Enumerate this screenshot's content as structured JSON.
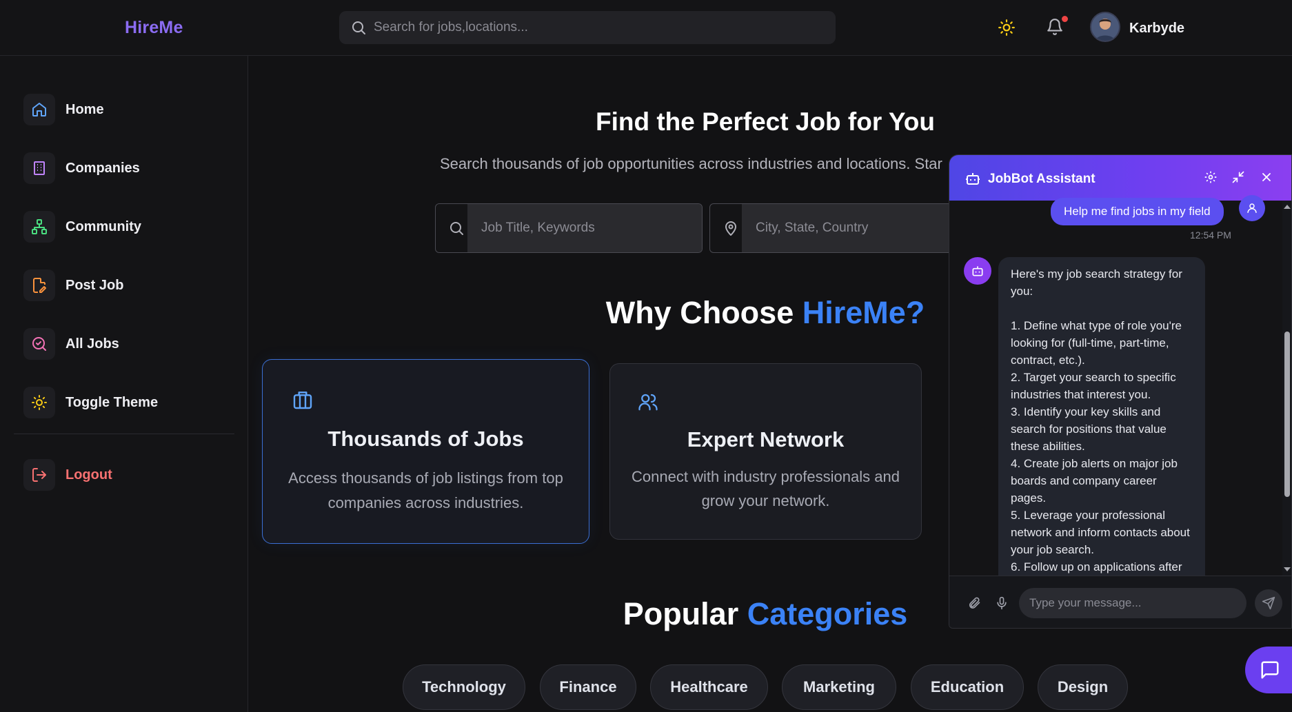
{
  "app": {
    "brand": "HireMe"
  },
  "header": {
    "search_placeholder": "Search for jobs,locations...",
    "username": "Karbyde"
  },
  "sidebar": {
    "items": [
      {
        "label": "Home",
        "icon": "home-icon"
      },
      {
        "label": "Companies",
        "icon": "building-icon"
      },
      {
        "label": "Community",
        "icon": "network-icon"
      },
      {
        "label": "Post Job",
        "icon": "file-edit-icon"
      },
      {
        "label": "All Jobs",
        "icon": "search-check-icon"
      },
      {
        "label": "Toggle Theme",
        "icon": "sun-icon"
      }
    ],
    "logout_label": "Logout"
  },
  "hero": {
    "title": "Find the Perfect Job for You",
    "subtitle": "Search thousands of job opportunities across industries and locations. Star",
    "job_placeholder": "Job Title, Keywords",
    "location_placeholder": "City, State, Country"
  },
  "why": {
    "title_prefix": "Why Choose ",
    "title_accent": "HireMe?",
    "cards": [
      {
        "title": "Thousands of Jobs",
        "desc": "Access thousands of job listings from top companies across industries."
      },
      {
        "title": "Expert Network",
        "desc": "Connect with industry professionals and grow your network."
      }
    ]
  },
  "categories": {
    "title_prefix": "Popular ",
    "title_accent": "Categories",
    "items": [
      "Technology",
      "Finance",
      "Healthcare",
      "Marketing",
      "Education",
      "Design"
    ]
  },
  "chat": {
    "title": "JobBot Assistant",
    "user_message": "Help me find jobs in my field",
    "time": "12:54 PM",
    "bot_message": "Here's my job search strategy for you:\n\n1. Define what type of role you're looking for (full-time, part-time, contract, etc.).\n2. Target your search to specific industries that interest you.\n3. Identify your key skills and search for positions that value these abilities.\n4. Create job alerts on major job boards and company career pages.\n5. Leverage your professional network and inform contacts about your job search.\n6. Follow up on applications after",
    "input_placeholder": "Type your message..."
  },
  "colors": {
    "brand": "#8b6cf2",
    "accent": "#3b82f6",
    "chat_header": "#6d3ff0",
    "logout": "#f87171"
  }
}
